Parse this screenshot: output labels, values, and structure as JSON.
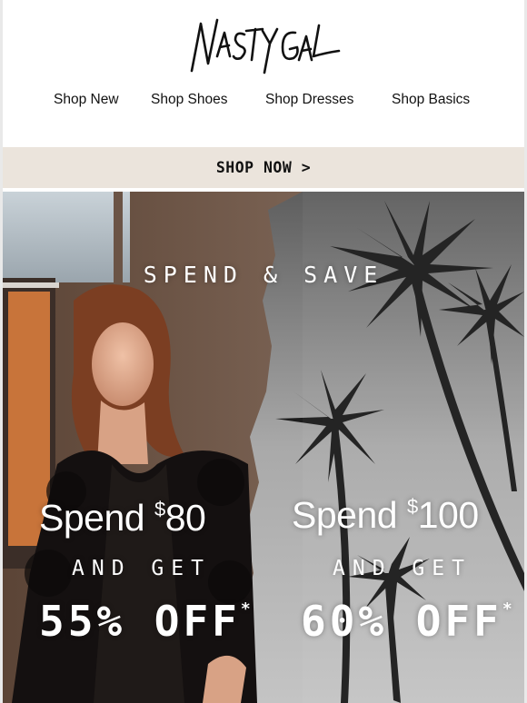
{
  "brand": {
    "logo_text": "Nasty Gal"
  },
  "nav": {
    "items": [
      {
        "label": "Shop New"
      },
      {
        "label": "Shop Shoes"
      },
      {
        "label": "Shop Dresses"
      },
      {
        "label": "Shop Basics"
      }
    ]
  },
  "cta_bar": {
    "label": "SHOP NOW >"
  },
  "hero": {
    "headline": "SPEND & SAVE",
    "offers": [
      {
        "spend_word": "Spend",
        "currency": "$",
        "amount": "80",
        "and_get": "AND GET",
        "discount": "55% OFF",
        "asterisk": "*"
      },
      {
        "spend_word": "Spend",
        "currency": "$",
        "amount": "100",
        "and_get": "AND GET",
        "discount": "60% OFF",
        "asterisk": "*"
      }
    ]
  },
  "colors": {
    "cta_background": "#ebe4dc",
    "text": "#111111",
    "hero_text": "#ffffff"
  }
}
